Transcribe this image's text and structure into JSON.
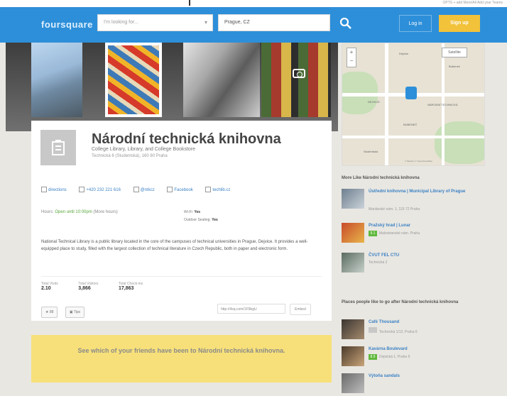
{
  "topbar": {
    "note": "OPTS + add More/All Add your Teams"
  },
  "header": {
    "logo": "foursquare",
    "what_placeholder": "I'm looking for...",
    "near_value": "Prague, CZ",
    "login_label": "Log in",
    "signup_label": "Sign up"
  },
  "venue": {
    "title": "Národní technická knihovna",
    "categories": "College Library, Library, and College Bookstore",
    "address": "Technická 6 (Studentská), 160 80 Praha",
    "links": [
      "directions",
      "+420 232 221 616",
      "@ntkcz",
      "Facebook",
      "techlib.cz"
    ],
    "hours_label": "Hours:",
    "hours_value": "Open until 10:00pm",
    "hours_more": "(More hours)",
    "wifi_label": "Wi-Fi:",
    "wifi_value": "Yes",
    "outdoor_label": "Outdoor Seating:",
    "outdoor_value": "Yes",
    "description": "National Technical Library is a public library located in the core of the campuses of technical universities in Prague, Dejvice. It provides a well-equipped place to study, filled with the largest collection of technical literature in Czech Republic, both in paper and electronic form.",
    "stats": [
      {
        "label": "Total Visits",
        "value": "2.10"
      },
      {
        "label": "Total Visitors",
        "value": "3,866"
      },
      {
        "label": "Total Check-ins",
        "value": "17,863"
      }
    ],
    "save_label": "88",
    "tip_label": "Tips",
    "share_url": "http://4sq.com/1F9bgU",
    "embed_label": "Embed",
    "friends_banner": "See which of your friends have been to Národní technická knihovna."
  },
  "map": {
    "map_btn": "Satellite",
    "labels": [
      "Dejvice",
      "DEJVICE",
      "BUBENEČ",
      "Bubeneč",
      "Studentská",
      "NÁRODNÍ TECHNICKÁ"
    ],
    "copyright": "© Mapbox © OpenStreetMap"
  },
  "sidebar": {
    "similar_heading": "More Like Národní technická knihovna",
    "similar": [
      {
        "name": "Ústřední knihovna | Municipal Library of Prague",
        "sub": "Mariánské nám. 1, 115 72 Praha",
        "score": ""
      },
      {
        "name": "Pražský hrad | Lunar",
        "sub": "Malostranské nám. Praha",
        "score": "9.1"
      },
      {
        "name": "ČVUT FEL CTU",
        "sub": "Technická 2",
        "score": ""
      }
    ],
    "after_heading": "Places people like to go after Národní technická knihovna",
    "after": [
      {
        "name": "Café Thousand",
        "sub": "Technická 1/12, Praha 6",
        "score": ""
      },
      {
        "name": "Kavárna Boulevard",
        "sub": "Dejvická 1, Praha 6",
        "score": "8.9"
      },
      {
        "name": "Výtoňa sandals",
        "sub": "",
        "score": ""
      }
    ]
  }
}
